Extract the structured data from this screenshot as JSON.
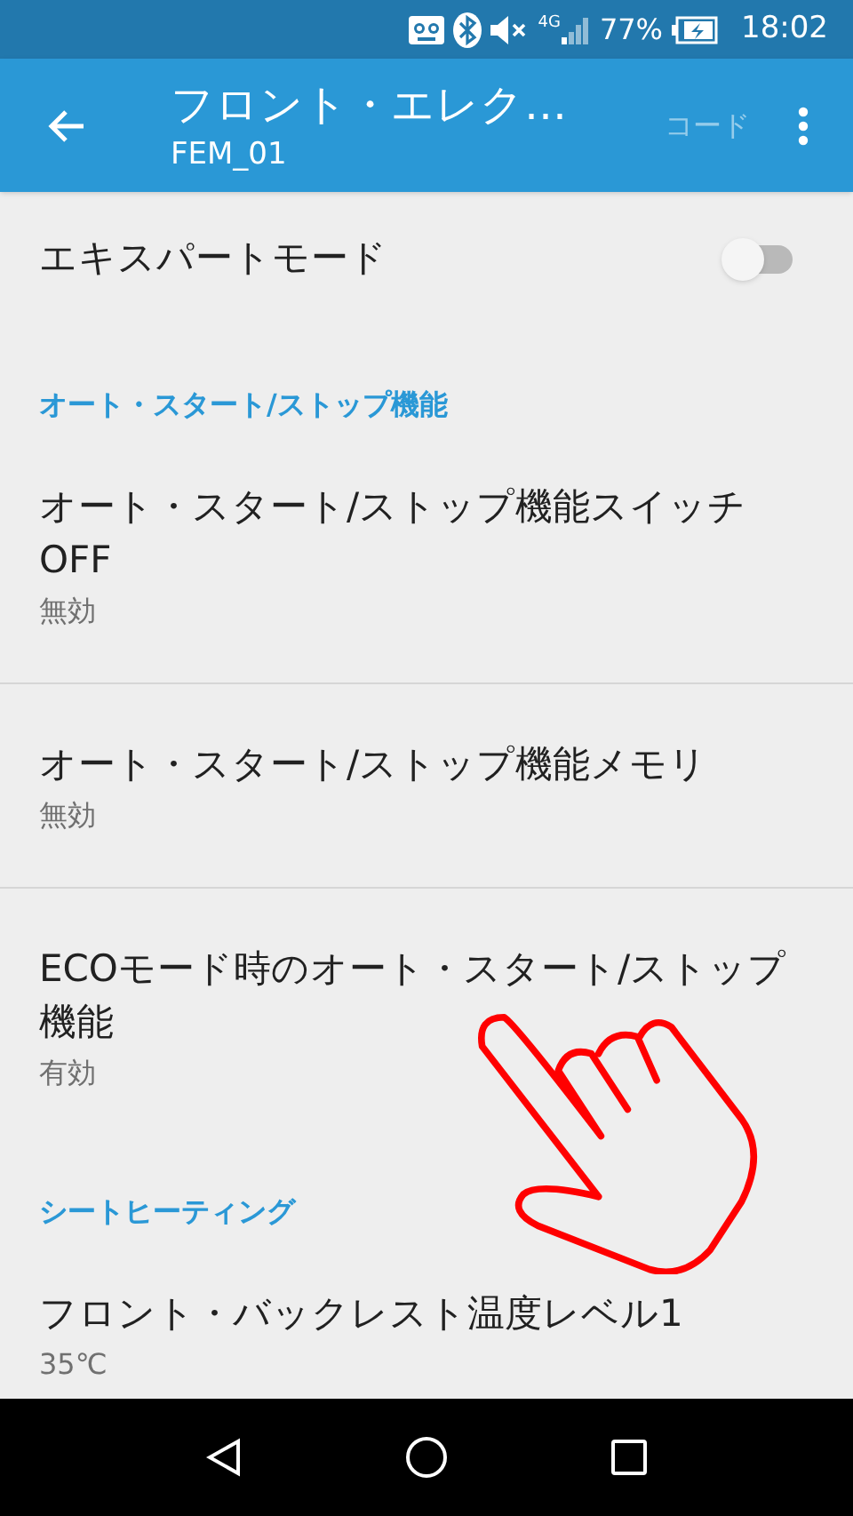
{
  "status_bar": {
    "network": "4G",
    "battery": "77%",
    "time": "18:02"
  },
  "app_bar": {
    "title": "フロント・エレク…",
    "subtitle": "FEM_01",
    "action": "コード",
    "action_disabled": true
  },
  "items": [
    {
      "kind": "switch",
      "title": "エキスパートモード",
      "on": false
    },
    {
      "kind": "header",
      "title": "オート・スタート/ストップ機能"
    },
    {
      "kind": "setting",
      "title": "オート・スタート/ストップ機能スイッチOFF",
      "summary": "無効"
    },
    {
      "kind": "setting",
      "title": "オート・スタート/ストップ機能メモリ",
      "summary": "無効"
    },
    {
      "kind": "setting",
      "title": "ECOモード時のオート・スタート/ストップ機能",
      "summary": "有効"
    },
    {
      "kind": "header",
      "title": "シートヒーティング"
    },
    {
      "kind": "setting",
      "title": "フロント・バックレスト温度レベル1",
      "summary": "35℃"
    }
  ]
}
